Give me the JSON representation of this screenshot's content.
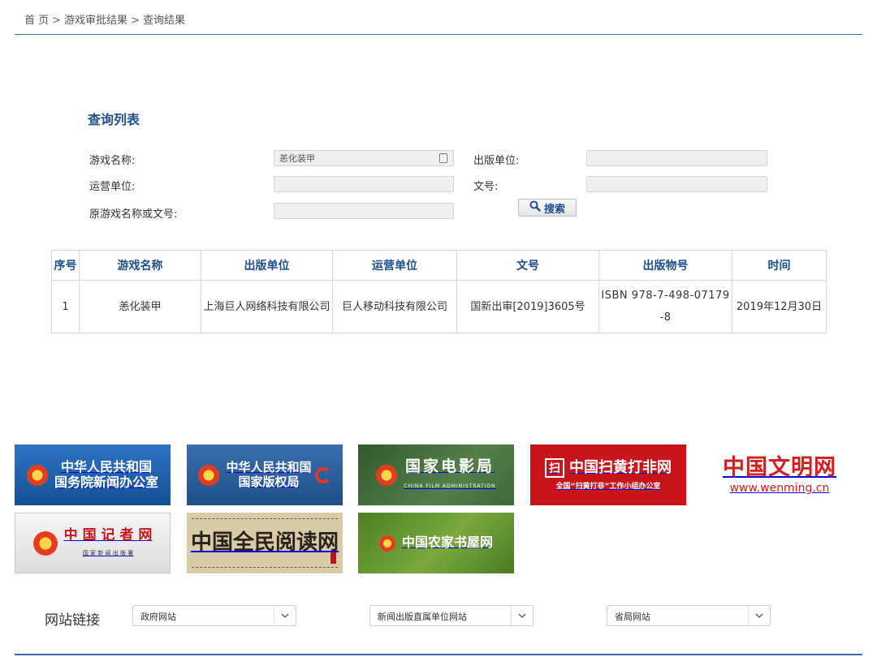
{
  "breadcrumb": {
    "home": "首 页",
    "sep": ">",
    "level2": "游戏审批结果",
    "level3": "查询结果"
  },
  "section_title": "查询列表",
  "form": {
    "game_name_label": "游戏名称:",
    "game_name_value": "恙化装甲",
    "publisher_label": "出版单位:",
    "publisher_value": "",
    "operator_label": "运营单位:",
    "operator_value": "",
    "doc_no_label": "文号:",
    "doc_no_value": "",
    "original_label": "原游戏名称或文号:",
    "original_value": "",
    "search_label": "搜索",
    "search_icon": "magnifier-icon"
  },
  "table": {
    "headers": [
      "序号",
      "游戏名称",
      "出版单位",
      "运营单位",
      "文号",
      "出版物号",
      "时间"
    ],
    "rows": [
      [
        "1",
        "恙化装甲",
        "上海巨人网络科技有限公司",
        "巨人移动科技有限公司",
        "国新出审[2019]3605号",
        "ISBN 978-7-498-07179-8",
        "2019年12月30日"
      ]
    ]
  },
  "banners": [
    {
      "line1": "中华人民共和国",
      "line2": "国务院新闻办公室",
      "bg": "#1d5ea8"
    },
    {
      "line1": "中华人民共和国",
      "line2": "国家版权局",
      "bg": "#2a5c9a"
    },
    {
      "line1": "国家电影局",
      "line2": "CHINA FILM ADMINISTRATION",
      "bg": "#3d6b3a"
    },
    {
      "line1": "中国扫黄打非网",
      "line2": "全国“扫黄打非”工作小组办公室",
      "bg": "#c8141b",
      "badge": "扫"
    },
    {
      "line1": "中国文明网",
      "line2": "www.wenming.cn",
      "bg": "#ffffff"
    },
    {
      "line1": "中 国 记 者 网",
      "line2": "国 家 新 闻 出 版 署",
      "bg": "#e9e9e9"
    },
    {
      "line1": "中国全民阅读网",
      "bg": "#d8c9a5"
    },
    {
      "line1": "中国农家书屋网",
      "bg": "#5b8a2b"
    }
  ],
  "footer": {
    "links_title": "网站链接",
    "select1": "政府网站",
    "select2": "新闻出版直属单位网站",
    "select3": "省局网站"
  },
  "colors": {
    "accent": "#1f4e8c",
    "rule": "#3a6aa8"
  }
}
